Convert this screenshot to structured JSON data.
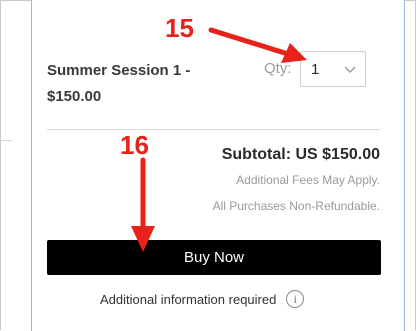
{
  "item": {
    "name_line1": "Summer Session 1 -",
    "name_line2": "$150.00"
  },
  "quantity": {
    "label": "Qty:",
    "value": "1"
  },
  "summary": {
    "subtotal": "Subtotal: US $150.00",
    "fees_note": "Additional Fees May Apply.",
    "refund_note": "All Purchases Non-Refundable."
  },
  "actions": {
    "buy_label": "Buy Now"
  },
  "info": {
    "text": "Additional information required",
    "icon_glyph": "i",
    "icon": "info-circle-icon"
  },
  "annotations": {
    "step_a": "15",
    "step_b": "16",
    "color": "#e8211a"
  },
  "colors": {
    "button_bg": "#000000",
    "button_text": "#ffffff",
    "muted_text": "#9a9a9a"
  }
}
